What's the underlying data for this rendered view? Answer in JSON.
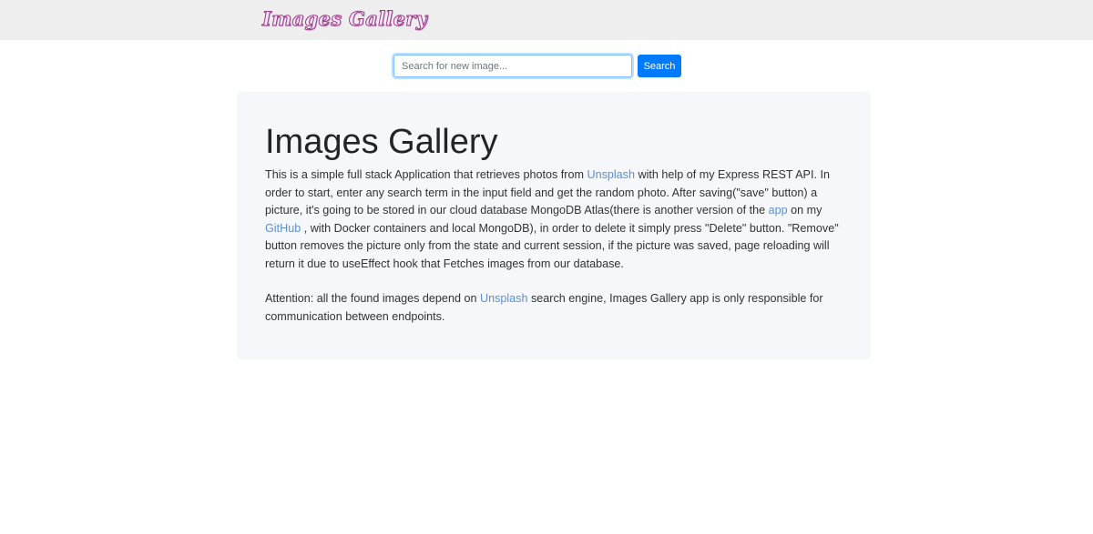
{
  "navbar": {
    "brand": "Images Gallery"
  },
  "search": {
    "placeholder": "Search for new image...",
    "button_label": "Search"
  },
  "jumbotron": {
    "title": "Images Gallery",
    "p1": {
      "t1": "This is a simple full stack Application that retrieves photos from ",
      "link_unsplash": "Unsplash",
      "t2": " with help of my Express REST API. In order to start, enter any search term in the input field and get the random photo. After saving(\"save\" button) a picture, it's going to be stored in our cloud database MongoDB Atlas(there is another version of the ",
      "link_app": "app",
      "t3": " on my ",
      "link_github": "GitHub",
      "t4": " , with Docker containers and local MongoDB), in order to delete it simply press \"Delete\" button. \"Remove\" button removes the picture only from the state and current session, if the picture was saved, page reloading will return it due to useEffect hook that Fetches images from our database."
    },
    "p2": {
      "t1": "Attention: all the found images depend on ",
      "link_unsplash": "Unsplash",
      "t2": " search engine, Images Gallery app is only responsible for communication between endpoints."
    }
  },
  "colors": {
    "navbar_bg": "#efeeef",
    "primary_button": "#007bff",
    "link": "#5d8fd0",
    "jumbotron_bg": "#f6f7fa",
    "brand_outline": "#9b3d86"
  }
}
